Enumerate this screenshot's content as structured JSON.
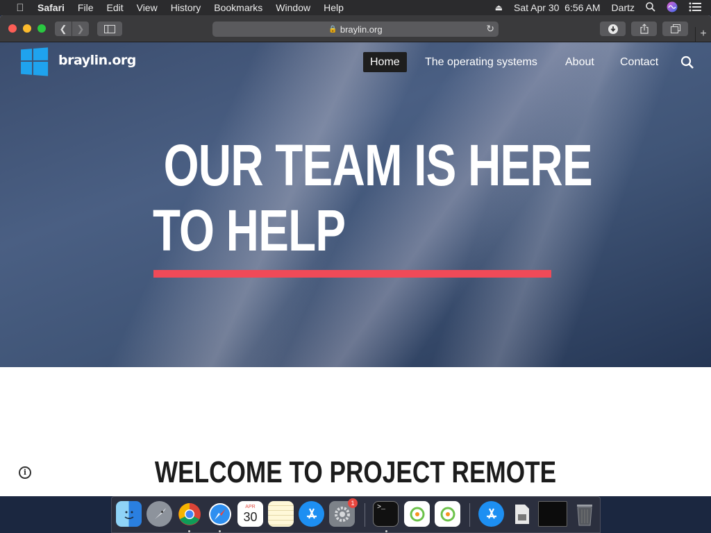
{
  "menubar": {
    "app_name": "Safari",
    "items": [
      "File",
      "Edit",
      "View",
      "History",
      "Bookmarks",
      "Window",
      "Help"
    ],
    "datetime": "Sat Apr 30  6:56 AM",
    "user": "Dartz",
    "icons": [
      "apple-icon",
      "eject-icon",
      "spotlight-search-icon",
      "siri-icon",
      "notification-center-icon"
    ]
  },
  "browser": {
    "address": "braylin.org",
    "toolbar_icons": [
      "back-icon",
      "forward-icon",
      "sidebar-icon",
      "lock-icon",
      "reload-icon",
      "download-icon",
      "share-icon",
      "tabs-overview-icon",
      "new-tab-icon"
    ]
  },
  "site": {
    "name": "braylin.org",
    "nav": {
      "home": "Home",
      "os": "The operating systems",
      "about": "About",
      "contact": "Contact"
    },
    "hero": {
      "line1": "OUR TEAM IS HERE",
      "line2": "TO HELP",
      "accent_color": "#f04a58"
    },
    "welcome": "WELCOME TO PROJECT REMOTE",
    "logo_color": "#1fa3ee"
  },
  "dock": {
    "apps": [
      "Finder",
      "Launchpad",
      "Google Chrome",
      "Safari",
      "Calendar",
      "Notes",
      "App Store",
      "System Preferences",
      "Terminal",
      "Odnoklassniki",
      "Odnoklassniki",
      "App Store",
      "Preview",
      "Screen",
      "Trash"
    ],
    "calendar": {
      "month": "APR",
      "day": "30"
    },
    "system_prefs_badge": "1"
  }
}
